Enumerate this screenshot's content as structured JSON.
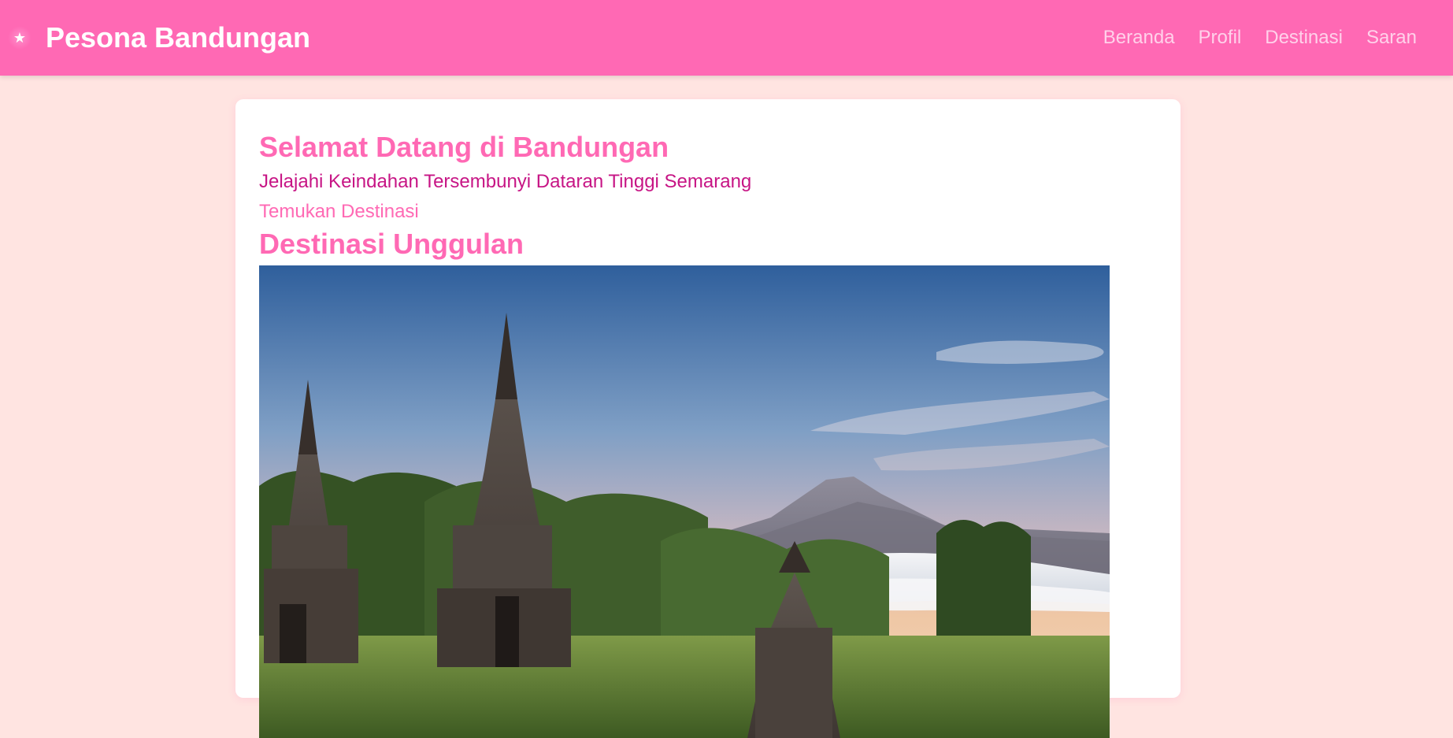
{
  "header": {
    "brand_title": "Pesona Bandungan",
    "logo_icon": "star-icon",
    "logo_glyph": "★",
    "nav": [
      {
        "label": "Beranda"
      },
      {
        "label": "Profil"
      },
      {
        "label": "Destinasi"
      },
      {
        "label": "Saran"
      }
    ]
  },
  "hero": {
    "title": "Selamat Datang di Bandungan",
    "subtitle": "Jelajahi Keindahan Tersembunyi Dataran Tinggi Semarang",
    "cta_label": "Temukan Destinasi"
  },
  "featured": {
    "title": "Destinasi Unggulan",
    "image_alt": "Candi Gedong Songo dengan latar gunung"
  },
  "colors": {
    "primary": "#ff69b4",
    "background": "#ffe4e1",
    "card": "#ffffff",
    "subtitle": "#c71585",
    "nav_text": "#ffd1ea"
  }
}
